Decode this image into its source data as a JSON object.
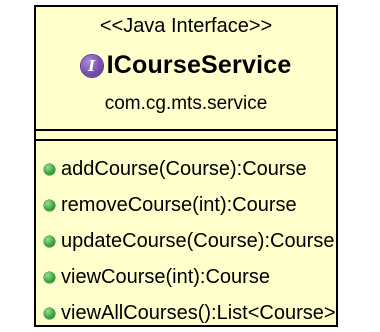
{
  "interface": {
    "stereotype": "<<Java Interface>>",
    "icon_letter": "I",
    "icon_color": "#7a4fb3",
    "name": "ICourseService",
    "package": "com.cg.mts.service",
    "background_color": "#ffffcc",
    "operation_icon_color": "#3aa53a",
    "operations": [
      {
        "label": "addCourse(Course):Course"
      },
      {
        "label": "removeCourse(int):Course"
      },
      {
        "label": "updateCourse(Course):Course"
      },
      {
        "label": "viewCourse(int):Course"
      },
      {
        "label": "viewAllCourses():List<Course>"
      }
    ]
  }
}
